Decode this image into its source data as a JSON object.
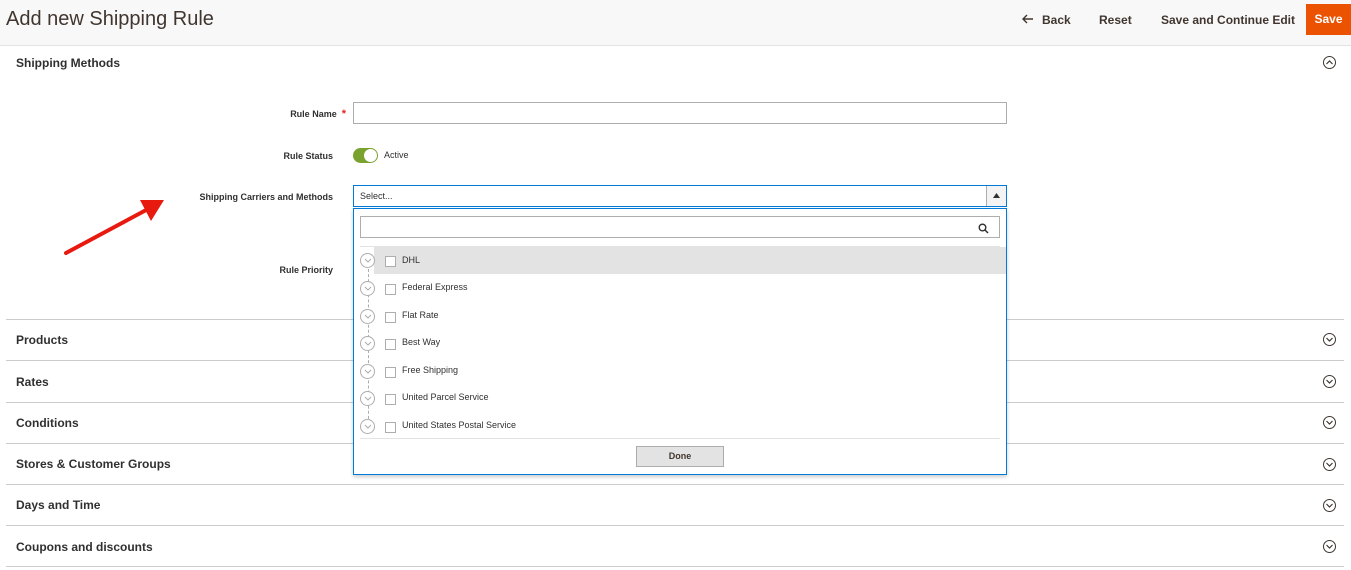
{
  "header": {
    "title": "Add new Shipping Rule",
    "back_label": "Back",
    "reset_label": "Reset",
    "save_continue_label": "Save and Continue Edit",
    "save_label": "Save"
  },
  "shipping_methods": {
    "title": "Shipping Methods",
    "rule_name_label": "Rule Name",
    "required_mark": "*",
    "rule_name_value": "",
    "rule_status_label": "Rule Status",
    "rule_status_value": "Active",
    "carriers_label": "Shipping Carriers and Methods",
    "carriers_placeholder": "Select...",
    "rule_priority_label": "Rule Priority",
    "dropdown": {
      "search_value": "",
      "options": [
        {
          "label": "DHL",
          "checked": false,
          "highlighted": true
        },
        {
          "label": "Federal Express",
          "checked": false
        },
        {
          "label": "Flat Rate",
          "checked": false
        },
        {
          "label": "Best Way",
          "checked": false
        },
        {
          "label": "Free Shipping",
          "checked": false
        },
        {
          "label": "United Parcel Service",
          "checked": false
        },
        {
          "label": "United States Postal Service",
          "checked": false
        }
      ],
      "done_label": "Done"
    }
  },
  "sections": [
    {
      "title": "Products"
    },
    {
      "title": "Rates"
    },
    {
      "title": "Conditions"
    },
    {
      "title": "Stores & Customer Groups"
    },
    {
      "title": "Days and Time"
    },
    {
      "title": "Coupons and discounts"
    }
  ],
  "colors": {
    "primary_button": "#eb5202",
    "toggle_on": "#79a22e",
    "focus_border": "#007bdb",
    "annotation_arrow": "#e8190f"
  },
  "icons": {
    "back": "arrow-left-icon",
    "collapse": "chevron-up-circle-icon",
    "expand": "chevron-down-circle-icon",
    "search": "search-icon",
    "caret": "caret-up-icon"
  }
}
